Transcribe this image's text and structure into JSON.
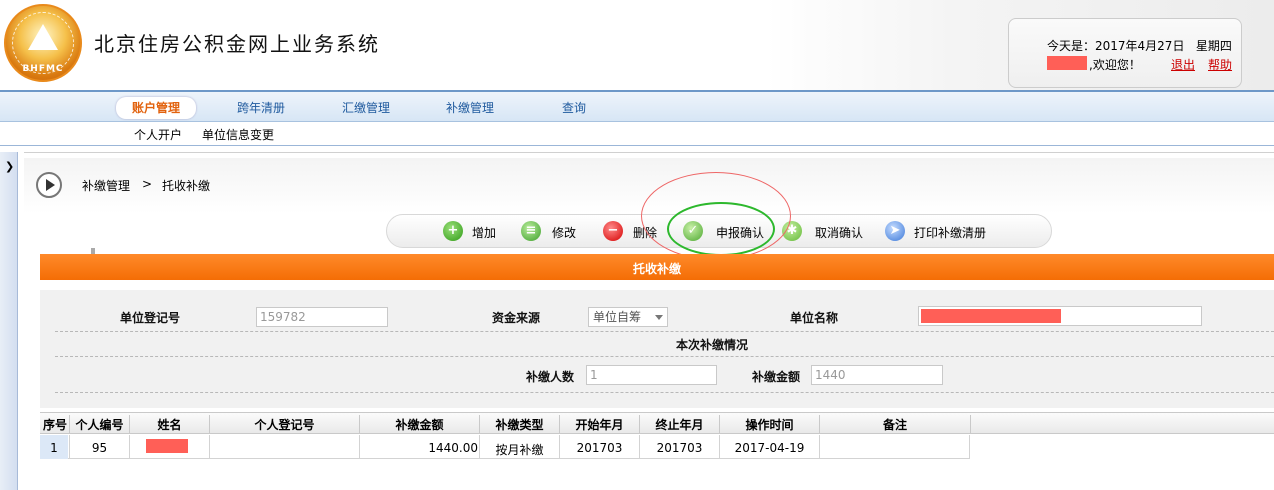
{
  "header": {
    "logo_text": "BHFMC",
    "logo_arc_text": "北京住房公积金管理中心",
    "system_title": "北京住房公积金网上业务系统",
    "today_label": "今天是：2017年4月27日",
    "weekday": "星期四",
    "welcome": ",欢迎您！",
    "logout": "退出",
    "help": "帮助"
  },
  "nav": {
    "tabs": [
      {
        "label": "账户管理",
        "active": true
      },
      {
        "label": "跨年清册",
        "active": false
      },
      {
        "label": "汇缴管理",
        "active": false
      },
      {
        "label": "补缴管理",
        "active": false
      },
      {
        "label": "查询",
        "active": false
      }
    ],
    "subnav": [
      "个人开户",
      "单位信息变更"
    ]
  },
  "breadcrumb": {
    "level1": "补缴管理",
    "separator": ">",
    "level2": "托收补缴"
  },
  "toolbar": {
    "add": "增加",
    "edit": "修改",
    "delete": "删除",
    "confirm": "申报确认",
    "cancel_confirm": "取消确认",
    "print": "打印补缴清册"
  },
  "section_title": "托收补缴",
  "form": {
    "unit_reg_label": "单位登记号",
    "unit_reg_value": "159782",
    "fund_source_label": "资金来源",
    "fund_source_value": "单位自筹",
    "unit_name_label": "单位名称",
    "subsection_title": "本次补缴情况",
    "count_label": "补缴人数",
    "count_value": "1",
    "amount_label": "补缴金额",
    "amount_value": "1440"
  },
  "table": {
    "headers": [
      "序号",
      "个人编号",
      "姓名",
      "个人登记号",
      "补缴金额",
      "补缴类型",
      "开始年月",
      "终止年月",
      "操作时间",
      "备注"
    ],
    "rows": [
      {
        "no": "1",
        "person_id": "95",
        "name": "",
        "reg_no": "",
        "amount": "1440.00",
        "type": "按月补缴",
        "start": "201703",
        "end": "201703",
        "op_time": "2017-04-19",
        "remark": ""
      }
    ]
  },
  "colors": {
    "nav_active_text": "#e2620e",
    "section_bar": "#f46d05",
    "link_red": "#cc0000",
    "redaction": "#ff5f57",
    "annotation_red": "#e66666",
    "annotation_green": "#2db82d"
  }
}
